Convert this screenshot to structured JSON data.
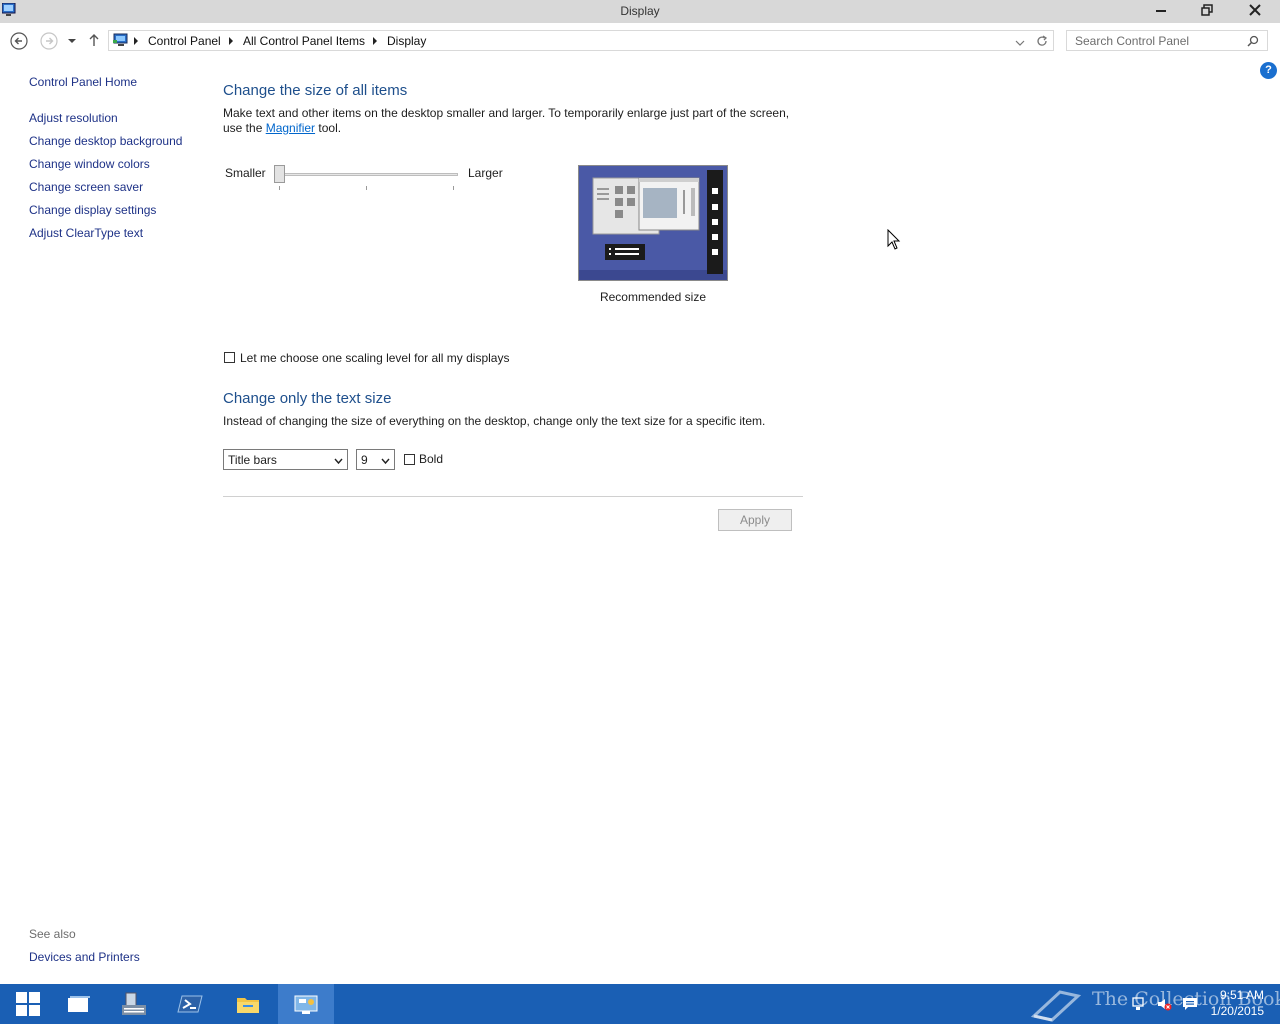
{
  "window": {
    "title": "Display"
  },
  "address_bar": {
    "crumbs": [
      "Control Panel",
      "All Control Panel Items",
      "Display"
    ]
  },
  "search": {
    "placeholder": "Search Control Panel"
  },
  "left_pane": {
    "home": "Control Panel Home",
    "links": [
      "Adjust resolution",
      "Change desktop background",
      "Change window colors",
      "Change screen saver",
      "Change display settings",
      "Adjust ClearType text"
    ],
    "see_also_heading": "See also",
    "see_also_links": [
      "Devices and Printers"
    ]
  },
  "size_section": {
    "heading": "Change the size of all items",
    "desc_part1": "Make text and other items on the desktop smaller and larger. To temporarily enlarge just part of the screen,",
    "desc_part2_prefix": "use the ",
    "magnifier_link": "Magnifier",
    "desc_part2_suffix": " tool.",
    "smaller_label": "Smaller",
    "larger_label": "Larger",
    "slider_level": 0,
    "preview_caption": "Recommended size"
  },
  "scaling_checkbox": {
    "label": "Let me choose one scaling level for all my displays",
    "checked": false
  },
  "text_section": {
    "heading": "Change only the text size",
    "desc": "Instead of changing the size of everything on the desktop, change only the text size for a specific item.",
    "item_select": "Title bars",
    "size_select": "9",
    "bold_label": "Bold",
    "bold_checked": false
  },
  "apply_label": "Apply",
  "taskbar": {
    "time": "9:51 AM",
    "date": "1/20/2015",
    "watermark": "The Collection Book"
  },
  "colors": {
    "accent": "#1a5fb4",
    "heading": "#1e4f8c",
    "link": "#1e3287"
  }
}
